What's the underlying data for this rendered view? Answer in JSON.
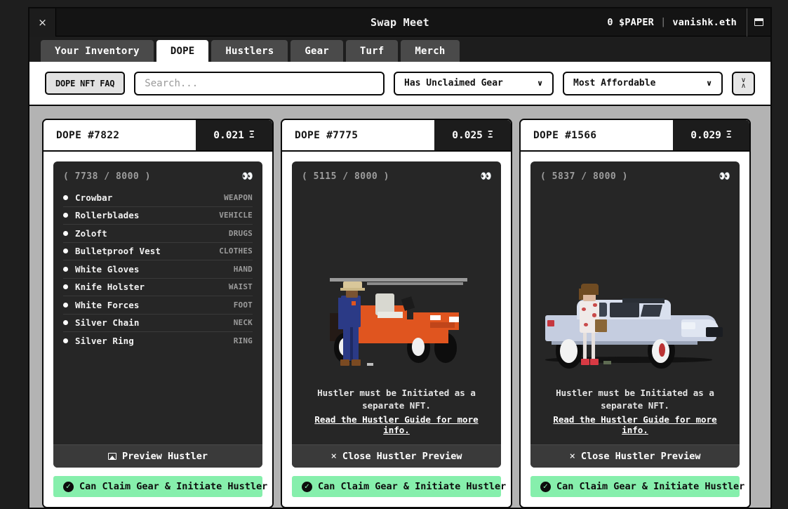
{
  "window": {
    "title": "Swap Meet",
    "close_label": "×",
    "paper_balance": "0 $PAPER",
    "separator": "|",
    "wallet": "vanishk.eth",
    "maximize_name": "maximize-window"
  },
  "tabs": [
    {
      "label": "Your Inventory",
      "active": false
    },
    {
      "label": "DOPE",
      "active": true
    },
    {
      "label": "Hustlers",
      "active": false
    },
    {
      "label": "Gear",
      "active": false
    },
    {
      "label": "Turf",
      "active": false
    },
    {
      "label": "Merch",
      "active": false
    }
  ],
  "toolbar": {
    "faq_label": "DOPE NFT FAQ",
    "search_placeholder": "Search...",
    "search_value": "",
    "filter_value": "Has Unclaimed Gear",
    "sort_value": "Most Affordable",
    "chevron": "∨",
    "sort_dir_up": "∨",
    "sort_dir_down": "∧"
  },
  "colors": {
    "accent_green": "#86efac",
    "panel_dark": "#262626",
    "window_chrome": "#141414",
    "page_bg": "#b3b3b3",
    "tab_inactive": "#4a4a4a"
  },
  "cards": [
    {
      "title": "DOPE #7822",
      "price": "0.021",
      "eth_symbol": "Ξ",
      "rank": "( 7738 / 8000 )",
      "eyes_icon": "👀",
      "mode": "items",
      "items": [
        {
          "name": "Crowbar",
          "slot": "WEAPON"
        },
        {
          "name": "Rollerblades",
          "slot": "VEHICLE"
        },
        {
          "name": "Zoloft",
          "slot": "DRUGS"
        },
        {
          "name": "Bulletproof Vest",
          "slot": "CLOTHES"
        },
        {
          "name": "White Gloves",
          "slot": "HAND"
        },
        {
          "name": "Knife Holster",
          "slot": "WAIST"
        },
        {
          "name": "White Forces",
          "slot": "FOOT"
        },
        {
          "name": "Silver Chain",
          "slot": "NECK"
        },
        {
          "name": "Silver Ring",
          "slot": "RING"
        }
      ],
      "action_label": "Preview Hustler",
      "action_icon": "image-icon",
      "status_label": "Can Claim Gear & Initiate Hustler"
    },
    {
      "title": "DOPE #7775",
      "price": "0.025",
      "eth_symbol": "Ξ",
      "rank": "( 5115 / 8000 )",
      "eyes_icon": "👀",
      "mode": "preview",
      "scene": "jeep",
      "note_line1": "Hustler must be Initiated as a",
      "note_line2": "separate NFT.",
      "note_link": "Read the Hustler Guide for more info.",
      "action_label": "Close Hustler Preview",
      "action_icon": "close-icon",
      "status_label": "Can Claim Gear & Initiate Hustler"
    },
    {
      "title": "DOPE #1566",
      "price": "0.029",
      "eth_symbol": "Ξ",
      "rank": "( 5837 / 8000 )",
      "eyes_icon": "👀",
      "mode": "preview",
      "scene": "sedan",
      "note_line1": "Hustler must be Initiated as a",
      "note_line2": "separate NFT.",
      "note_link": "Read the Hustler Guide for more info.",
      "action_label": "Close Hustler Preview",
      "action_icon": "close-icon",
      "status_label": "Can Claim Gear & Initiate Hustler"
    }
  ]
}
